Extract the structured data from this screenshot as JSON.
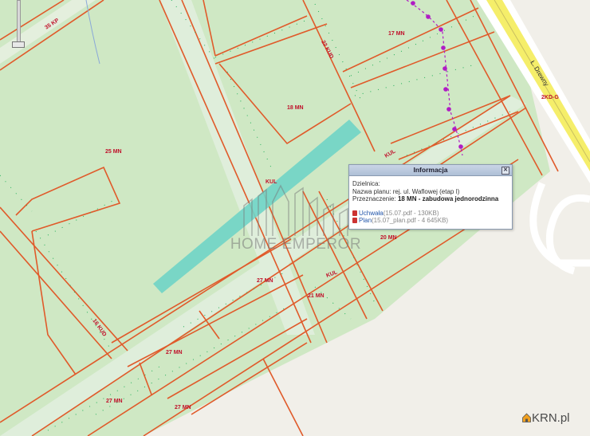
{
  "map": {
    "zones": [
      "25 MN",
      "18 MN",
      "17 MN",
      "20 MN",
      "27 MN",
      "27 MN",
      "27 MN",
      "27 MN",
      "21 MN"
    ],
    "roads": [
      "35 KP",
      "22 KUD",
      "KUL",
      "KUL",
      "KUL",
      "16 KUD",
      "2KD-G"
    ],
    "street": "Ł. Drewny"
  },
  "popup": {
    "title": "Informacja",
    "district_label": "Dzielnica:",
    "plan_label": "Nazwa planu:",
    "plan_value": "rej. ul. Waflowej (etap I)",
    "purpose_label": "Przeznaczenie:",
    "purpose_value": "18 MN - zabudowa jednorodzinna",
    "docs": [
      {
        "name": "Uchwała",
        "meta": "(15.07.pdf - 130KB)"
      },
      {
        "name": "Plan",
        "meta": "(15.07_plan.pdf - 4 645KB)"
      }
    ]
  },
  "watermark": "HOME EMPEROR",
  "brand": "KRN.pl",
  "colors": {
    "zone": "#cfe8c4",
    "boundary": "#e05a2a",
    "highlight": "#6fd4c6",
    "road_yellow": "#f5ee6a",
    "utility": "#b01cc4"
  }
}
